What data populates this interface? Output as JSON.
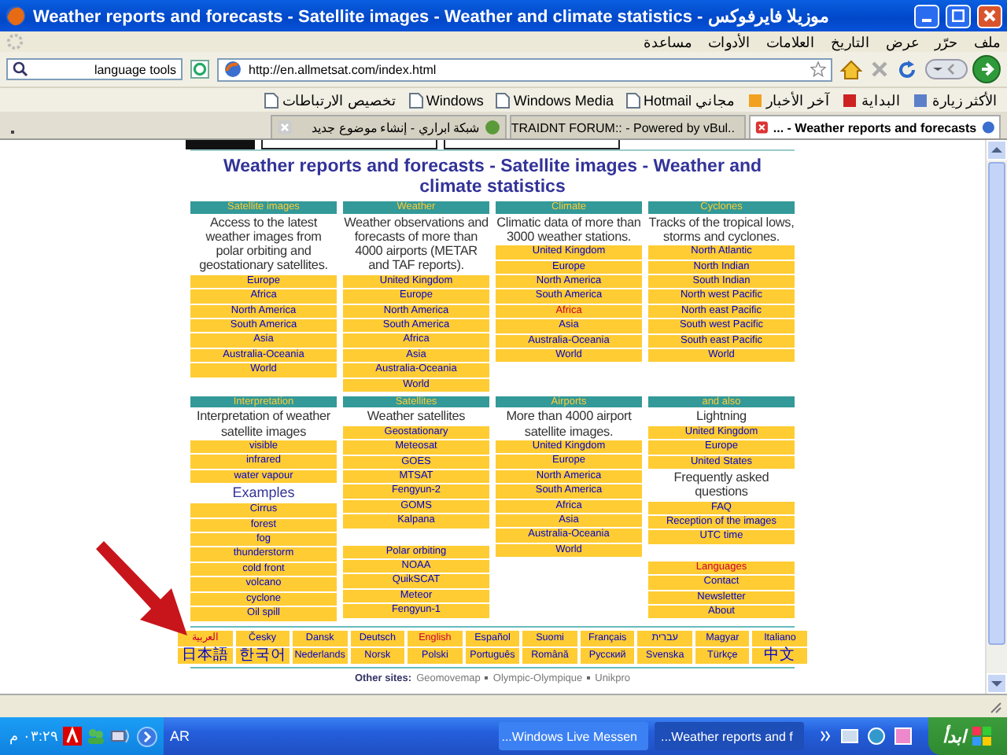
{
  "window": {
    "title": "Weather reports and forecasts - Satellite images - Weather and climate statistics - موزيلا فايرفوكس"
  },
  "menu": [
    "ملف",
    "حرّر",
    "عرض",
    "التاريخ",
    "العلامات",
    "الأدوات",
    "مساعدة"
  ],
  "search_field": {
    "value": "language tools"
  },
  "address_bar": {
    "value": "http://en.allmetsat.com/index.html"
  },
  "bookmarks": [
    "الأكثر زيارة",
    "البداية",
    "آخر الأخبار",
    "Hotmail مجاني",
    "Windows Media",
    "Windows",
    "تخصيص الارتباطات"
  ],
  "tabs": [
    {
      "label": "شبكة ابراري - إنشاء موضوع جديد",
      "selected": false
    },
    {
      "label": "..TRAIDNT FORUM:: - Powered by vBul",
      "selected": false
    },
    {
      "label": "Weather reports and forecasts - ...",
      "selected": true
    }
  ],
  "page": {
    "heading": "Weather reports and forecasts - Satellite images - Weather and climate statistics",
    "grids": [
      [
        {
          "header": "Satellite images",
          "items": [
            {
              "kind": "text",
              "text": "Access to the latest weather images from polar orbiting and geostationary satellites."
            },
            {
              "kind": "link",
              "label": "Europe",
              "visited": false
            },
            {
              "kind": "link",
              "label": "Africa",
              "visited": false
            },
            {
              "kind": "link",
              "label": "North America",
              "visited": false
            },
            {
              "kind": "link",
              "label": "South America",
              "visited": false
            },
            {
              "kind": "link",
              "label": "Asia",
              "visited": false
            },
            {
              "kind": "link",
              "label": "Australia-Oceania",
              "visited": false
            },
            {
              "kind": "link",
              "label": "World",
              "visited": false
            }
          ]
        },
        {
          "header": "Weather",
          "items": [
            {
              "kind": "text",
              "text": "Weather observations and forecasts of more than 4000 airports (METAR and TAF reports)."
            },
            {
              "kind": "link",
              "label": "United Kingdom",
              "visited": false
            },
            {
              "kind": "link",
              "label": "Europe",
              "visited": false
            },
            {
              "kind": "link",
              "label": "North America",
              "visited": false
            },
            {
              "kind": "link",
              "label": "South America",
              "visited": false
            },
            {
              "kind": "link",
              "label": "Africa",
              "visited": false
            },
            {
              "kind": "link",
              "label": "Asia",
              "visited": false
            },
            {
              "kind": "link",
              "label": "Australia-Oceania",
              "visited": false
            },
            {
              "kind": "link",
              "label": "World",
              "visited": false
            }
          ]
        },
        {
          "header": "Climate",
          "items": [
            {
              "kind": "text",
              "text": "Climatic data of more than 3000 weather stations."
            },
            {
              "kind": "link",
              "label": "United Kingdom",
              "visited": false
            },
            {
              "kind": "link",
              "label": "Europe",
              "visited": false
            },
            {
              "kind": "link",
              "label": "North America",
              "visited": false
            },
            {
              "kind": "link",
              "label": "South America",
              "visited": false
            },
            {
              "kind": "link",
              "label": "Africa",
              "visited": true
            },
            {
              "kind": "link",
              "label": "Asia",
              "visited": false
            },
            {
              "kind": "link",
              "label": "Australia-Oceania",
              "visited": false
            },
            {
              "kind": "link",
              "label": "World",
              "visited": false
            }
          ]
        },
        {
          "header": "Cyclones",
          "items": [
            {
              "kind": "text",
              "text": "Tracks of the tropical lows, storms and cyclones."
            },
            {
              "kind": "link",
              "label": "North Atlantic",
              "visited": false
            },
            {
              "kind": "link",
              "label": "North Indian",
              "visited": false
            },
            {
              "kind": "link",
              "label": "South Indian",
              "visited": false
            },
            {
              "kind": "link",
              "label": "North west Pacific",
              "visited": false
            },
            {
              "kind": "link",
              "label": "North east Pacific",
              "visited": false
            },
            {
              "kind": "link",
              "label": "South west Pacific",
              "visited": false
            },
            {
              "kind": "link",
              "label": "South east Pacific",
              "visited": false
            },
            {
              "kind": "link",
              "label": "World",
              "visited": false
            }
          ]
        }
      ],
      [
        {
          "header": "Interpretation",
          "items": [
            {
              "kind": "text",
              "text": "Interpretation of weather satellite images"
            },
            {
              "kind": "link",
              "label": "visible",
              "visited": false
            },
            {
              "kind": "link",
              "label": "infrared",
              "visited": false
            },
            {
              "kind": "link",
              "label": "water vapour",
              "visited": false
            },
            {
              "kind": "subheading",
              "text": "Examples"
            },
            {
              "kind": "link",
              "label": "Cirrus",
              "visited": false
            },
            {
              "kind": "link",
              "label": "forest",
              "visited": false
            },
            {
              "kind": "link",
              "label": "fog",
              "visited": false
            },
            {
              "kind": "link",
              "label": "thunderstorm",
              "visited": false
            },
            {
              "kind": "link",
              "label": "cold front",
              "visited": false
            },
            {
              "kind": "link",
              "label": "volcano",
              "visited": false
            },
            {
              "kind": "link",
              "label": "cyclone",
              "visited": false
            },
            {
              "kind": "link",
              "label": "Oil spill",
              "visited": false
            }
          ]
        },
        {
          "header": "Satellites",
          "items": [
            {
              "kind": "text",
              "text": "Weather satellites"
            },
            {
              "kind": "link",
              "label": "Geostationary",
              "visited": false
            },
            {
              "kind": "link",
              "label": "Meteosat",
              "visited": false
            },
            {
              "kind": "link",
              "label": "GOES",
              "visited": false
            },
            {
              "kind": "link",
              "label": "MTSAT",
              "visited": false
            },
            {
              "kind": "link",
              "label": "Fengyun-2",
              "visited": false
            },
            {
              "kind": "link",
              "label": "GOMS",
              "visited": false
            },
            {
              "kind": "link",
              "label": "Kalpana",
              "visited": false
            },
            {
              "kind": "spacer"
            },
            {
              "kind": "link",
              "label": "Polar orbiting",
              "visited": false
            },
            {
              "kind": "link",
              "label": "NOAA",
              "visited": false
            },
            {
              "kind": "link",
              "label": "QuikSCAT",
              "visited": false
            },
            {
              "kind": "link",
              "label": "Meteor",
              "visited": false
            },
            {
              "kind": "link",
              "label": "Fengyun-1",
              "visited": false
            }
          ]
        },
        {
          "header": "Airports",
          "items": [
            {
              "kind": "text",
              "text": "More than 4000 airport satellite images."
            },
            {
              "kind": "link",
              "label": "United Kingdom",
              "visited": false
            },
            {
              "kind": "link",
              "label": "Europe",
              "visited": false
            },
            {
              "kind": "link",
              "label": "North America",
              "visited": false
            },
            {
              "kind": "link",
              "label": "South America",
              "visited": false
            },
            {
              "kind": "link",
              "label": "Africa",
              "visited": false
            },
            {
              "kind": "link",
              "label": "Asia",
              "visited": false
            },
            {
              "kind": "link",
              "label": "Australia-Oceania",
              "visited": false
            },
            {
              "kind": "link",
              "label": "World",
              "visited": false
            }
          ]
        },
        {
          "header": "and also",
          "items": [
            {
              "kind": "text",
              "text": "Lightning"
            },
            {
              "kind": "link",
              "label": "United Kingdom",
              "visited": false
            },
            {
              "kind": "link",
              "label": "Europe",
              "visited": false
            },
            {
              "kind": "link",
              "label": "United States",
              "visited": false
            },
            {
              "kind": "text",
              "text": "Frequently asked questions"
            },
            {
              "kind": "link",
              "label": "FAQ",
              "visited": false
            },
            {
              "kind": "link",
              "label": "Reception of the images",
              "visited": false
            },
            {
              "kind": "link",
              "label": "UTC time",
              "visited": false
            },
            {
              "kind": "spacer"
            },
            {
              "kind": "link",
              "label": "Languages",
              "visited": true
            },
            {
              "kind": "link",
              "label": "Contact",
              "visited": false
            },
            {
              "kind": "link",
              "label": "Newsletter",
              "visited": false
            },
            {
              "kind": "link",
              "label": "About",
              "visited": false
            }
          ]
        }
      ]
    ],
    "languages": [
      [
        {
          "label": "العربية",
          "visited": true
        },
        {
          "label": "Česky",
          "visited": false
        },
        {
          "label": "Dansk",
          "visited": false
        },
        {
          "label": "Deutsch",
          "visited": false
        },
        {
          "label": "English",
          "visited": true
        },
        {
          "label": "Español",
          "visited": false
        },
        {
          "label": "Suomi",
          "visited": false
        },
        {
          "label": "Français",
          "visited": false
        },
        {
          "label": "עברית",
          "visited": false
        },
        {
          "label": "Magyar",
          "visited": false
        },
        {
          "label": "Italiano",
          "visited": false
        }
      ],
      [
        {
          "label": "日本語",
          "visited": false
        },
        {
          "label": "한국어",
          "visited": false
        },
        {
          "label": "Nederlands",
          "visited": false
        },
        {
          "label": "Norsk",
          "visited": false
        },
        {
          "label": "Polski",
          "visited": false
        },
        {
          "label": "Português",
          "visited": false
        },
        {
          "label": "Română",
          "visited": false
        },
        {
          "label": "Русский",
          "visited": false
        },
        {
          "label": "Svenska",
          "visited": false
        },
        {
          "label": "Türkçe",
          "visited": false
        },
        {
          "label": "中文",
          "visited": false
        }
      ]
    ],
    "other_sites": {
      "label": "Other sites:",
      "links": [
        "Geomovemap",
        "Olympic-Olympique",
        "Unikpro"
      ]
    }
  },
  "taskbar": {
    "start": "ابدأ",
    "tasks": [
      {
        "label": "...Windows Live Messen",
        "selected": false
      },
      {
        "label": "...Weather reports and f",
        "selected": true
      }
    ],
    "language": "AR",
    "clock": "٠٣:٢٩ م"
  }
}
